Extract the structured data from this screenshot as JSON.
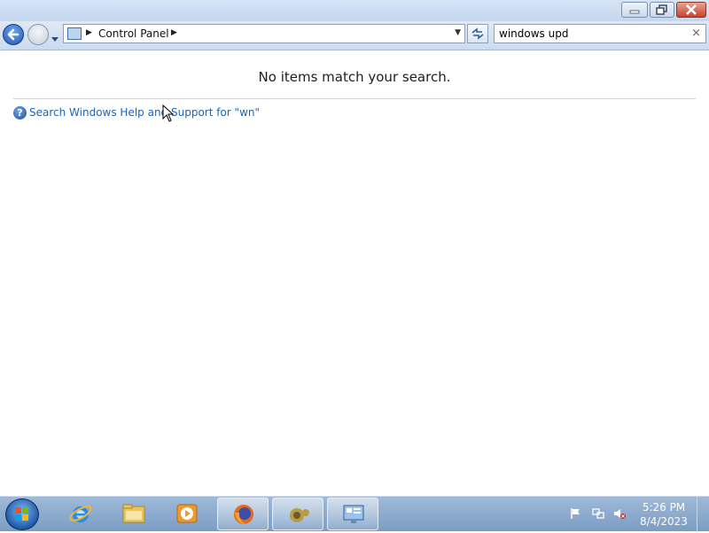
{
  "window": {
    "address": {
      "breadcrumb": [
        "Control Panel"
      ],
      "icon": "control-panel-icon"
    },
    "search": {
      "value": "windows upd",
      "clear_glyph": "×"
    },
    "results": {
      "empty_message": "No items match your search.",
      "help_link": "Search Windows Help and Support for \"wn\""
    }
  },
  "taskbar": {
    "start": "windows-orb-icon",
    "items": [
      {
        "name": "internet-explorer-icon",
        "open": false
      },
      {
        "name": "file-explorer-icon",
        "open": false
      },
      {
        "name": "media-player-icon",
        "open": false
      },
      {
        "name": "firefox-icon",
        "open": true
      },
      {
        "name": "gimp-icon",
        "open": true
      },
      {
        "name": "control-panel-icon",
        "open": true
      }
    ],
    "clock": {
      "time": "5:26 PM",
      "date": "8/4/2023"
    }
  }
}
